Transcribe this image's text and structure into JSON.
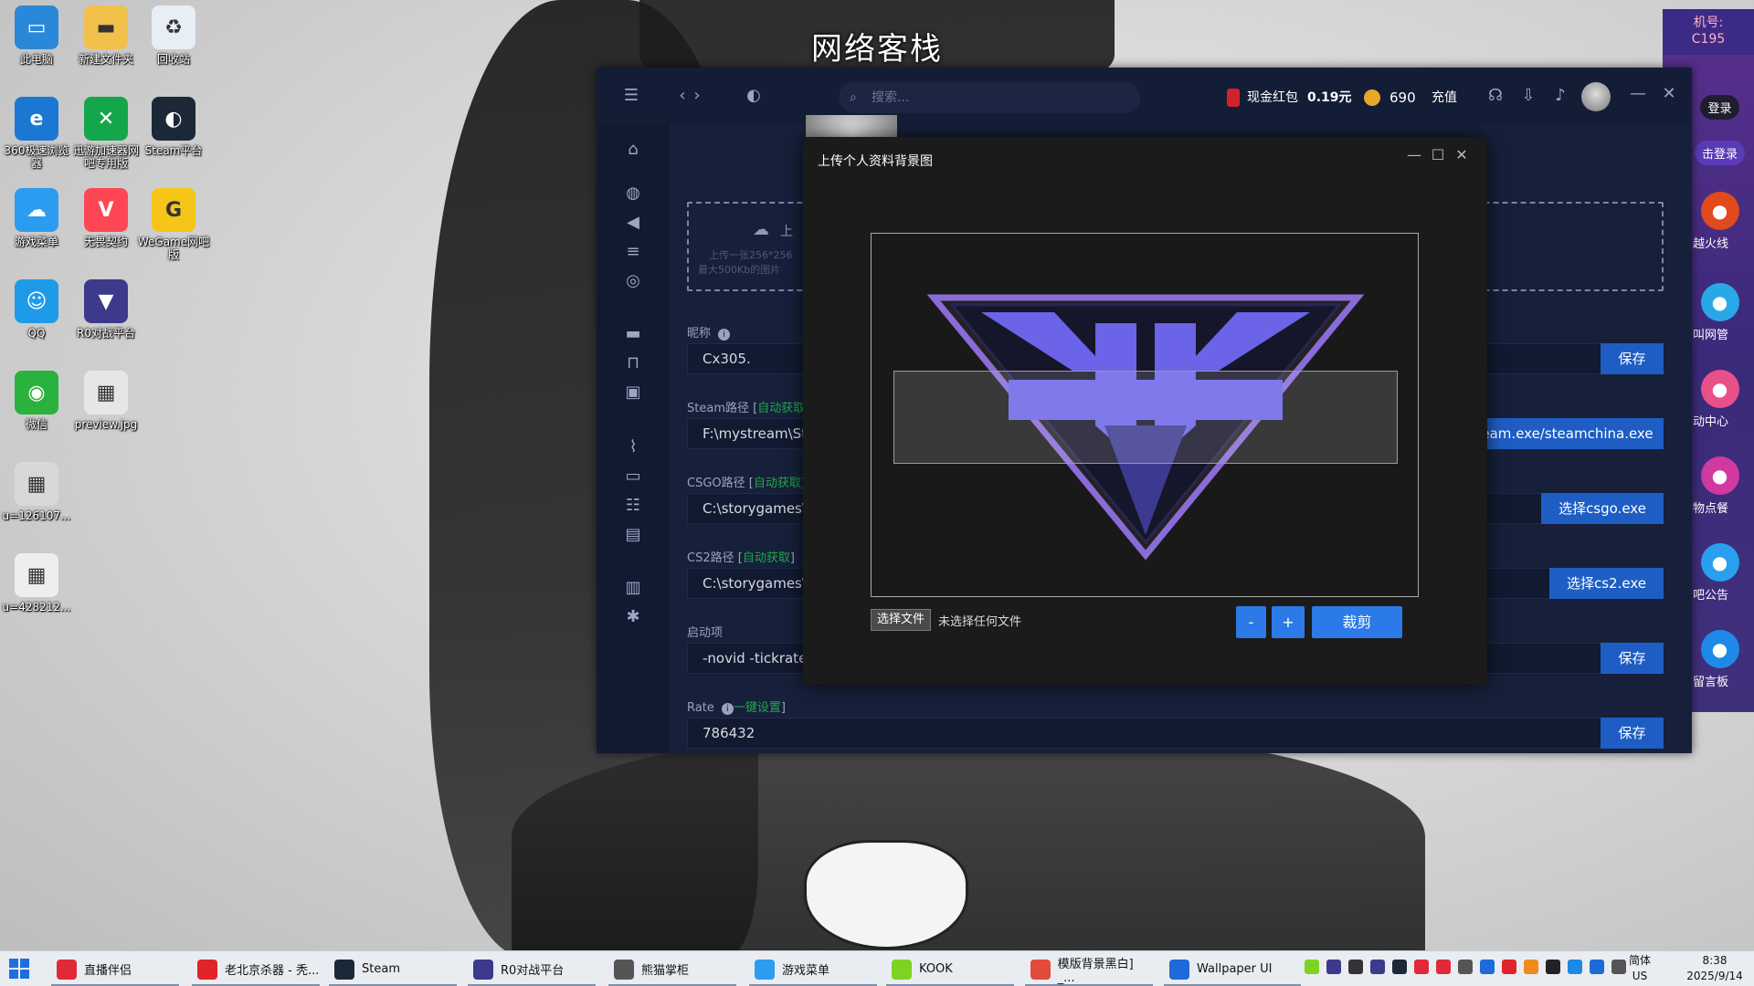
{
  "wallpaper": {
    "banner": "网络客栈"
  },
  "desktop_icons": [
    {
      "label": "此电脑",
      "icon": "computer-icon",
      "color": "#2a88d8"
    },
    {
      "label": "新建文件夹",
      "icon": "folder-icon",
      "color": "#f2c14c"
    },
    {
      "label": "回收站",
      "icon": "recycle-bin-icon",
      "color": "#e8eef5"
    },
    {
      "label": "360极速浏览器",
      "icon": "browser-icon",
      "color": "#1b78d2"
    },
    {
      "label": "迅游加速器网吧专用版",
      "icon": "accelerator-icon",
      "color": "#14a64b"
    },
    {
      "label": "Steam平台",
      "icon": "steam-icon",
      "color": "#1b2838"
    },
    {
      "label": "游戏菜单",
      "icon": "cloud-icon",
      "color": "#2c9cf0"
    },
    {
      "label": "无畏契约",
      "icon": "valorant-icon",
      "color": "#ff4655"
    },
    {
      "label": "WeGame网吧版",
      "icon": "wegame-icon",
      "color": "#f5c518"
    },
    {
      "label": "QQ",
      "icon": "qq-icon",
      "color": "#1e9be8"
    },
    {
      "label": "R0对战平台",
      "icon": "r0-icon",
      "color": "#3d3a8c"
    },
    {
      "label": "微信",
      "icon": "wechat-icon",
      "color": "#2bb13d"
    },
    {
      "label": "preview.jpg",
      "icon": "image-file-icon",
      "color": "#e6e6e6"
    },
    {
      "label": "u=126107...",
      "icon": "image-file-icon",
      "color": "#d8d8d8"
    },
    {
      "label": "u=428212...",
      "icon": "image-file-icon",
      "color": "#eeeeee"
    }
  ],
  "right_panel": {
    "machine": "机号:",
    "machine_id": "C195",
    "items": [
      {
        "label": "登录",
        "icon": "login-icon",
        "color": "#333"
      },
      {
        "label": "击登录",
        "icon": "click-login-icon",
        "color": "#4a4ab0"
      },
      {
        "label": "越火线",
        "icon": "crossfire-icon",
        "color": "#e04a1c"
      },
      {
        "label": "叫网管",
        "icon": "call-admin-icon",
        "color": "#29a8e8"
      },
      {
        "label": "动中心",
        "icon": "activity-icon",
        "color": "#e8508a"
      },
      {
        "label": "物点餐",
        "icon": "order-food-icon",
        "color": "#d03aa0"
      },
      {
        "label": "吧公告",
        "icon": "notice-icon",
        "color": "#2a9ff0"
      },
      {
        "label": "留言板",
        "icon": "message-board-icon",
        "color": "#1e8ae8"
      }
    ]
  },
  "app": {
    "search_placeholder": "搜索...",
    "redpack_label": "现金红包",
    "redpack_amount": "0.19元",
    "coins": "690",
    "recharge": "充值",
    "upload_prompt": "上",
    "upload_hint1": "上传一张256*256",
    "upload_hint2": "最大500Kb的图片",
    "fields": [
      {
        "label": "昵称",
        "value": "Cx305.",
        "button": "保存",
        "link": ""
      },
      {
        "label": "Steam路径 [",
        "value": "F:\\mystream\\Ste",
        "button": "eam.exe/steamchina.exe",
        "link": "自动获取"
      },
      {
        "label": "CSGO路径 [",
        "value": "C:\\storygames\\",
        "button": "选择csgo.exe",
        "link": "自动获取"
      },
      {
        "label": "CS2路径 [",
        "value": "C:\\storygames\\",
        "button": "选择cs2.exe",
        "link": "自动获取"
      },
      {
        "label": "启动项",
        "value": "-novid -tickrate",
        "button": "保存",
        "link": ""
      },
      {
        "label": "Rate",
        "value": "786432",
        "button": "保存",
        "link": "一键设置"
      }
    ]
  },
  "dialog": {
    "title": "上传个人资料背景图",
    "choose_file": "选择文件",
    "no_file": "未选择任何文件",
    "zoom_out": "-",
    "zoom_in": "+",
    "crop": "裁剪"
  },
  "taskbar": {
    "items": [
      {
        "label": "直播伴侣",
        "color": "#e02a3a"
      },
      {
        "label": "老北京杀器 - 秃...",
        "color": "#e0242a"
      },
      {
        "label": "Steam",
        "color": "#1b2838"
      },
      {
        "label": "R0对战平台",
        "color": "#3d3a8c"
      },
      {
        "label": "熊猫掌柜",
        "color": "#555"
      },
      {
        "label": "游戏菜单",
        "color": "#2c9cf0"
      },
      {
        "label": "KOOK",
        "color": "#7ed321"
      },
      {
        "label": "模版背景黑白] _...",
        "color": "#e24a3a"
      },
      {
        "label": "Wallpaper UI",
        "color": "#1e6ad8"
      }
    ],
    "ime": "简体",
    "ime2": "US",
    "time": "8:38",
    "date": "2025/9/14"
  }
}
